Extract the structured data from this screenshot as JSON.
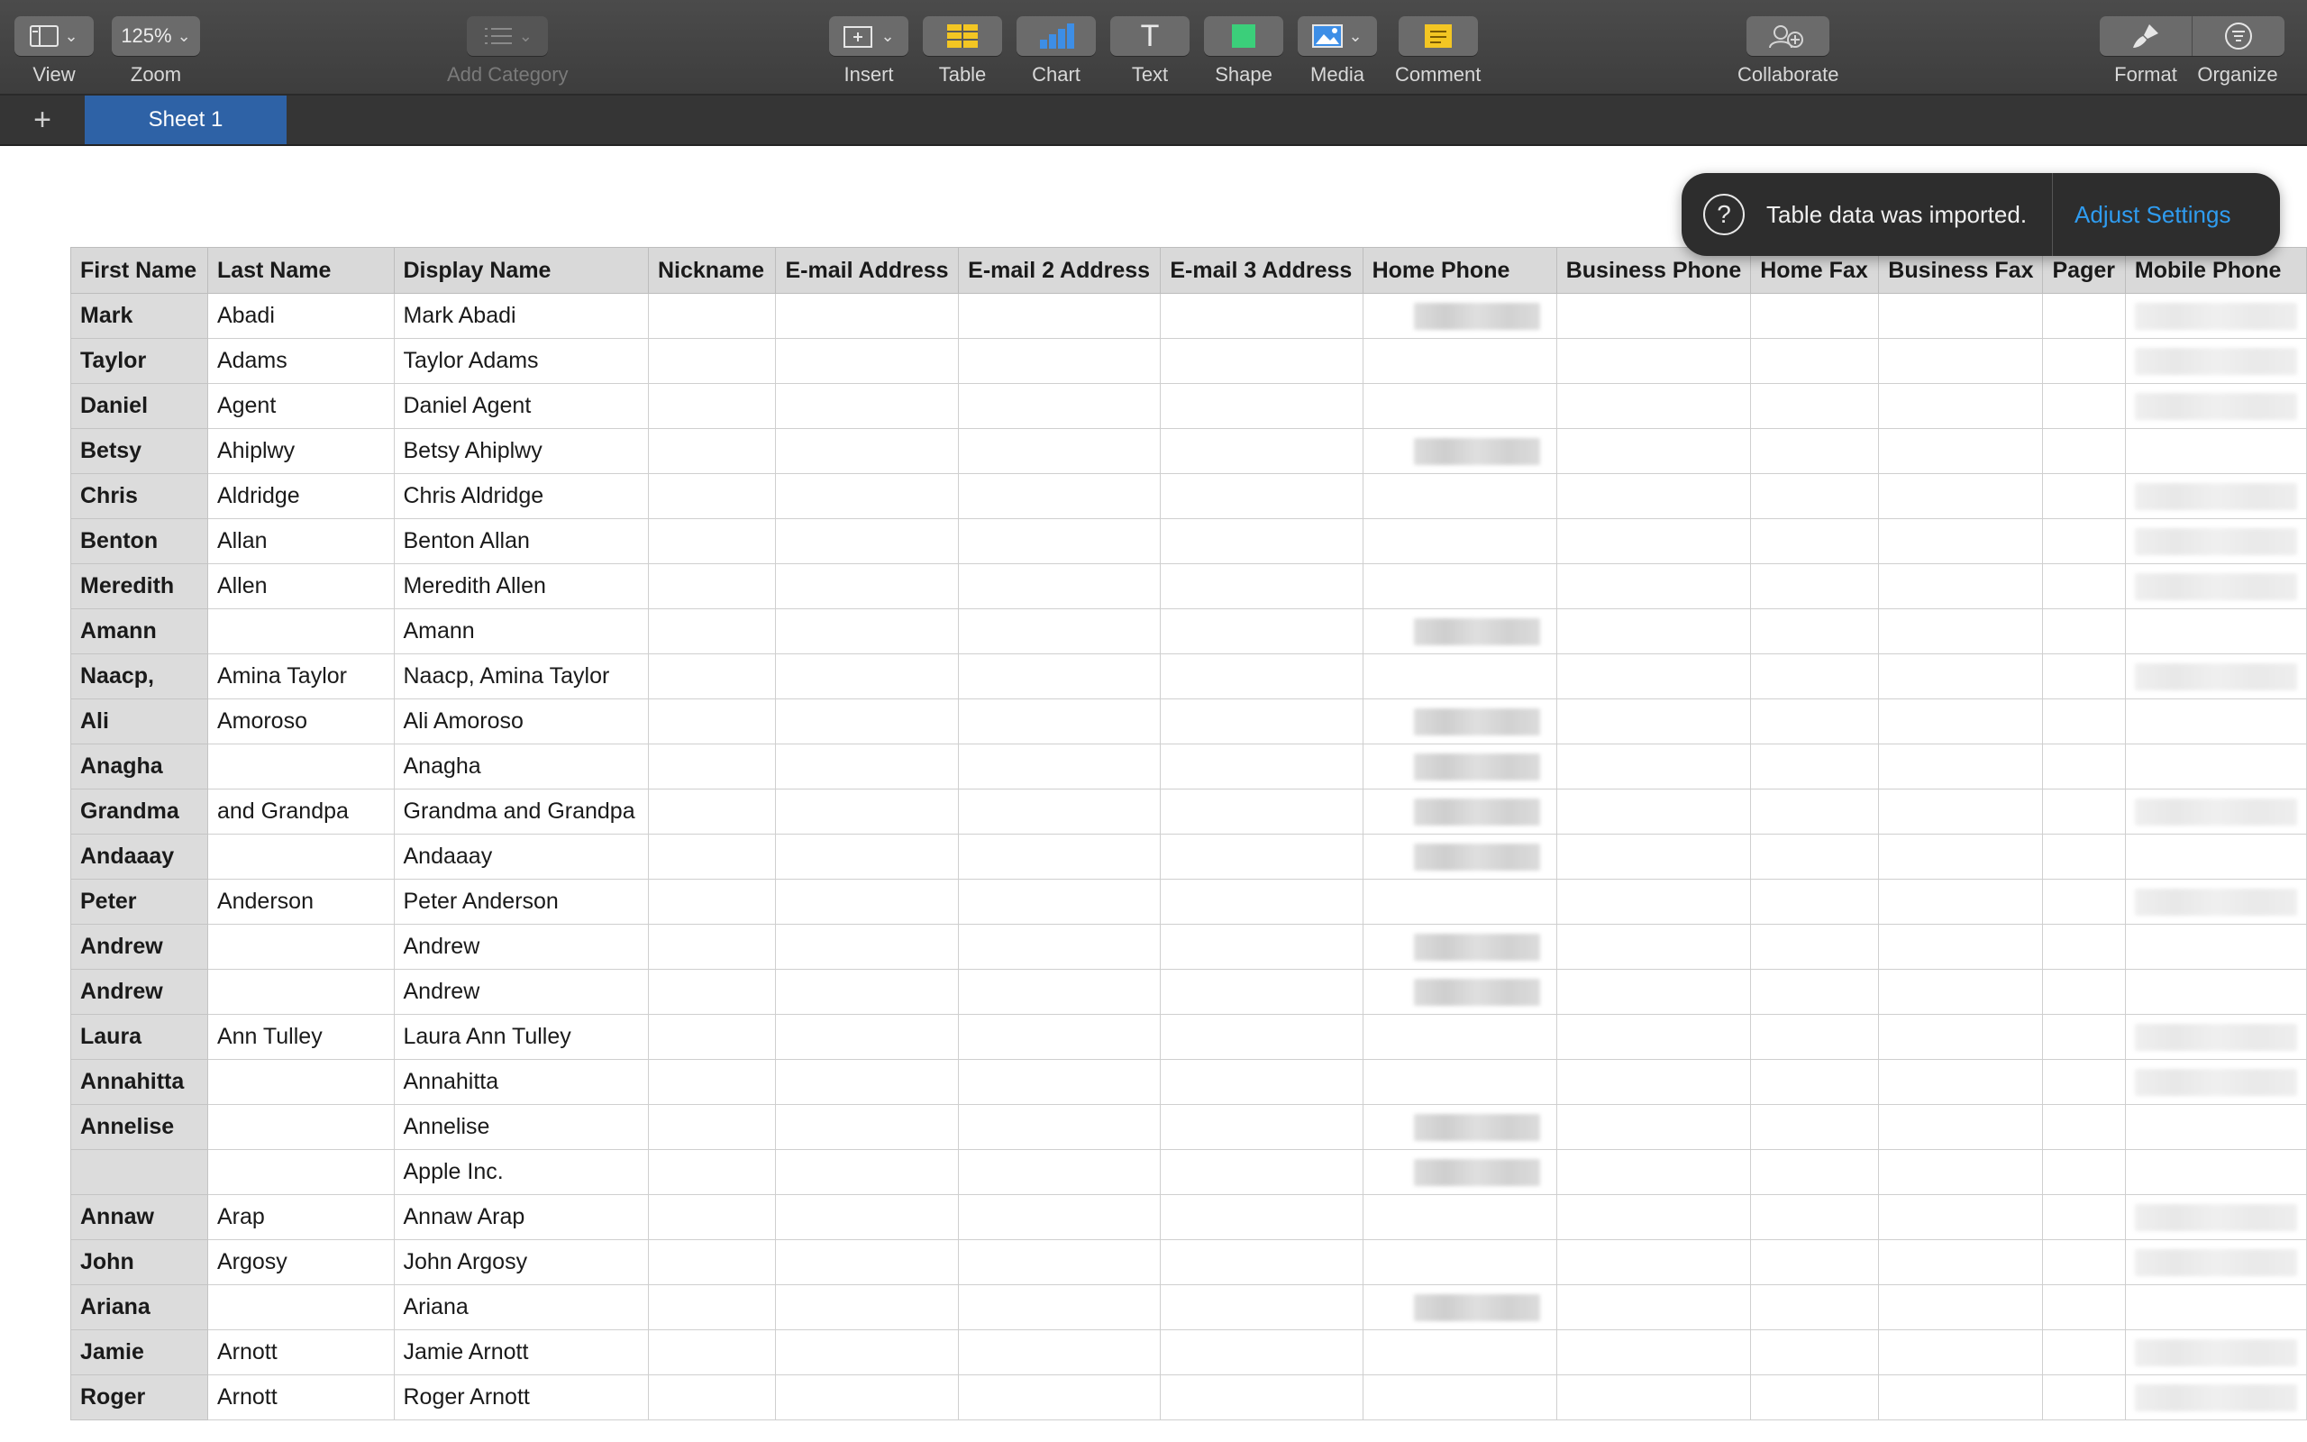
{
  "toolbar": {
    "view": {
      "label": "View",
      "icon": "sidebar-icon"
    },
    "zoom": {
      "label": "Zoom",
      "value": "125%"
    },
    "add_category": {
      "label": "Add Category",
      "icon": "list-icon"
    },
    "insert": {
      "label": "Insert",
      "icon": "insert-icon"
    },
    "table": {
      "label": "Table",
      "icon": "table-icon"
    },
    "chart": {
      "label": "Chart",
      "icon": "bar-chart-icon"
    },
    "text": {
      "label": "Text",
      "glyph": "T"
    },
    "shape": {
      "label": "Shape",
      "icon": "square-icon"
    },
    "media": {
      "label": "Media",
      "icon": "image-icon"
    },
    "comment": {
      "label": "Comment",
      "icon": "comment-icon"
    },
    "collaborate": {
      "label": "Collaborate",
      "icon": "collaborate-icon"
    },
    "format": {
      "label": "Format",
      "icon": "paintbrush-icon"
    },
    "organize": {
      "label": "Organize",
      "icon": "organize-icon"
    }
  },
  "sheets": {
    "add_glyph": "+",
    "active": "Sheet 1"
  },
  "toast": {
    "icon_glyph": "?",
    "message": "Table data was imported.",
    "action": "Adjust Settings"
  },
  "table": {
    "columns": [
      "First Name",
      "Last Name",
      "Display Name",
      "Nickname",
      "E-mail Address",
      "E-mail 2 Address",
      "E-mail 3 Address",
      "Home Phone",
      "Business Phone",
      "Home Fax",
      "Business Fax",
      "Pager",
      "Mobile Phone"
    ],
    "rows": [
      [
        "Mark",
        "Abadi",
        "Mark Abadi"
      ],
      [
        "Taylor",
        "Adams",
        "Taylor Adams"
      ],
      [
        "Daniel",
        "Agent",
        "Daniel Agent"
      ],
      [
        "Betsy",
        "Ahiplwy",
        "Betsy Ahiplwy"
      ],
      [
        "Chris",
        "Aldridge",
        "Chris Aldridge"
      ],
      [
        "Benton",
        "Allan",
        "Benton Allan"
      ],
      [
        "Meredith",
        "Allen",
        "Meredith Allen"
      ],
      [
        "Amann",
        "",
        "Amann"
      ],
      [
        "Naacp,",
        "Amina Taylor",
        "Naacp, Amina Taylor"
      ],
      [
        "Ali",
        "Amoroso",
        "Ali Amoroso"
      ],
      [
        "Anagha",
        "",
        "Anagha"
      ],
      [
        "Grandma",
        "and Grandpa",
        "Grandma and Grandpa"
      ],
      [
        "Andaaay",
        "",
        "Andaaay"
      ],
      [
        "Peter",
        "Anderson",
        "Peter Anderson"
      ],
      [
        "Andrew",
        "",
        "Andrew"
      ],
      [
        "Andrew",
        "",
        "Andrew"
      ],
      [
        "Laura",
        "Ann Tulley",
        "Laura Ann Tulley"
      ],
      [
        "Annahitta",
        "",
        "Annahitta"
      ],
      [
        "Annelise",
        "",
        "Annelise"
      ],
      [
        "",
        "",
        "Apple Inc."
      ],
      [
        "Annaw",
        "Arap",
        "Annaw Arap"
      ],
      [
        "John",
        "Argosy",
        "John  Argosy"
      ],
      [
        "Ariana",
        "",
        "Ariana"
      ],
      [
        "Jamie",
        "Arnott",
        "Jamie Arnott"
      ],
      [
        "Roger",
        "Arnott",
        "Roger Arnott"
      ]
    ],
    "home_phone_redacted": [
      true,
      false,
      false,
      true,
      false,
      false,
      false,
      true,
      false,
      true,
      true,
      true,
      true,
      false,
      true,
      true,
      false,
      false,
      true,
      true,
      false,
      false,
      true,
      false,
      false
    ],
    "mobile_phone_redacted": [
      true,
      true,
      true,
      false,
      true,
      true,
      true,
      false,
      true,
      false,
      false,
      true,
      false,
      true,
      false,
      false,
      true,
      true,
      false,
      false,
      true,
      true,
      false,
      true,
      true
    ]
  }
}
